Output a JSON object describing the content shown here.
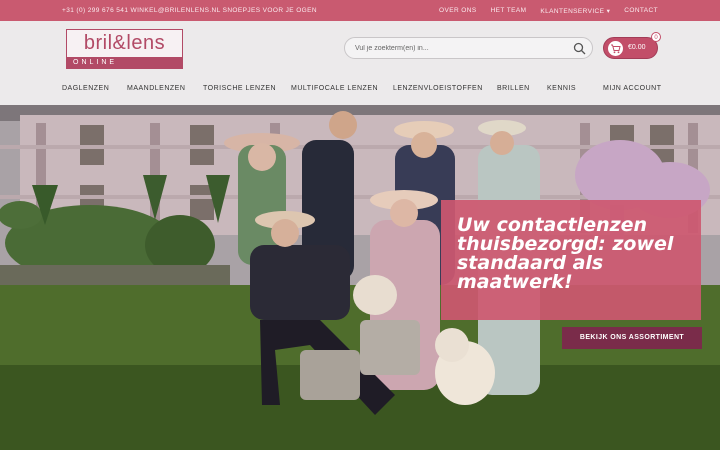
{
  "topbar": {
    "contact": "+31 (0) 299 676 541 WINKEL@BRILENLENS.NL SNOEPJES VOOR JE OGEN",
    "links": [
      "OVER ONS",
      "HET TEAM",
      "KLANTENSERVICE ▾",
      "CONTACT"
    ]
  },
  "logo": {
    "brand": "bril&lens",
    "sub": "ONLINE"
  },
  "search": {
    "placeholder": "Vul je zoekterm(en) in..."
  },
  "cart": {
    "amount": "€0.00",
    "count": "0"
  },
  "nav": [
    "DAGLENZEN",
    "MAANDLENZEN",
    "TORISCHE LENZEN",
    "MULTIFOCALE LENZEN",
    "LENZENVLOEISTOFFEN",
    "BRILLEN",
    "KENNIS",
    "MIJN ACCOUNT"
  ],
  "hero": {
    "headline": "Uw contactlenzen thuisbezorgd: zowel standaard als maatwerk!",
    "cta": "BEKIJK ONS ASSORTIMENT"
  },
  "colors": {
    "brand": "#c95a70",
    "cta": "#7a2c4a"
  }
}
